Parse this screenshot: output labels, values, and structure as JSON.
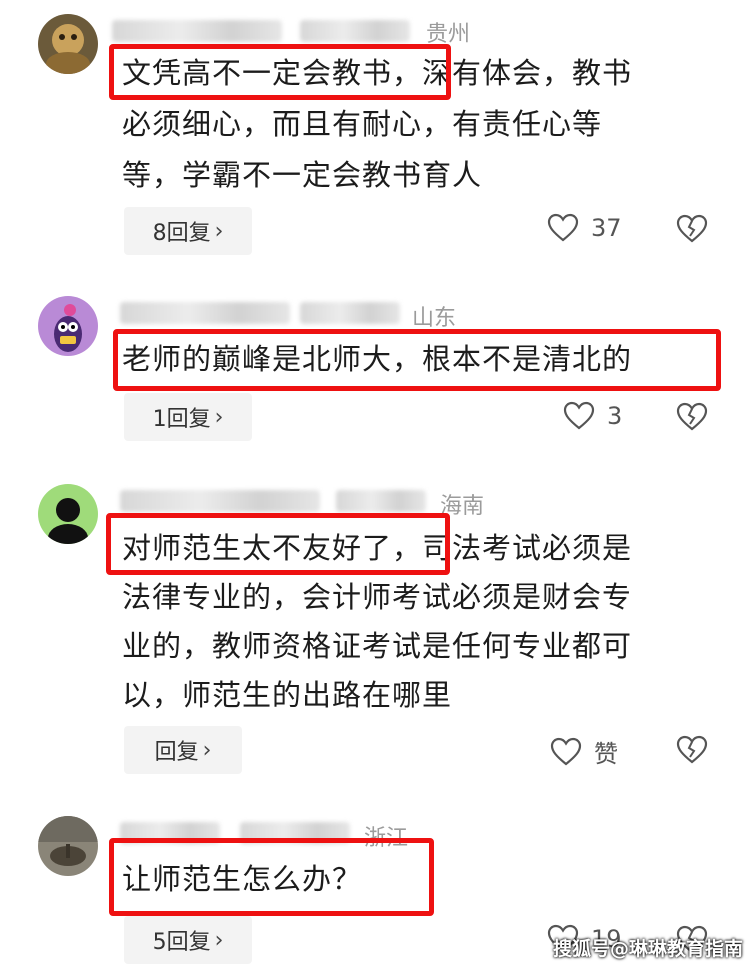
{
  "comments": [
    {
      "location": "贵州",
      "lines": [
        "文凭高不一定会教书，深有体会，教书",
        "必须细心，而且有耐心，有责任心等",
        "等，学霸不一定会教书育人"
      ],
      "reply_label": "8回复",
      "likes": "37"
    },
    {
      "location": "山东",
      "lines": [
        "老师的巅峰是北师大，根本不是清北的"
      ],
      "reply_label": "1回复",
      "likes": "3"
    },
    {
      "location": "海南",
      "lines": [
        "对师范生太不友好了，司法考试必须是",
        "法律专业的，会计师考试必须是财会专",
        "业的，教师资格证考试是任何专业都可",
        "以，师范生的出路在哪里"
      ],
      "reply_label": "回复",
      "likes": "赞"
    },
    {
      "location": "浙江",
      "lines": [
        "让师范生怎么办？"
      ],
      "reply_label": "5回复",
      "likes": "19"
    }
  ],
  "watermark": "搜狐号@琳琳教育指南",
  "colors": {
    "highlight": "#ee1111",
    "reply_bg": "#f3f3f3",
    "meta": "#9b9b9b"
  },
  "icons": {
    "like": "heart-outline-icon",
    "dislike": "broken-heart-icon",
    "expand": "chevron-right-icon"
  }
}
